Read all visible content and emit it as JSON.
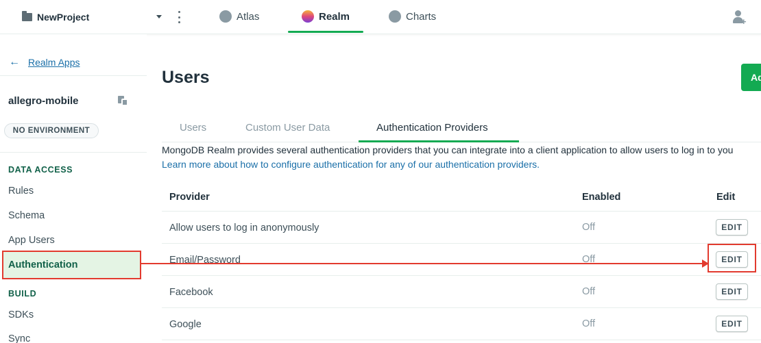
{
  "topbar": {
    "project_name": "NewProject",
    "tabs": [
      {
        "label": "Atlas",
        "icon": "atlas-icon"
      },
      {
        "label": "Realm",
        "icon": "realm-icon",
        "active": true
      },
      {
        "label": "Charts",
        "icon": "charts-icon"
      }
    ]
  },
  "sidebar": {
    "back_label": "Realm Apps",
    "app_name": "allegro-mobile",
    "environment": "NO ENVIRONMENT",
    "section_data_access": "DATA ACCESS",
    "items_data_access": [
      {
        "label": "Rules"
      },
      {
        "label": "Schema"
      },
      {
        "label": "App Users"
      },
      {
        "label": "Authentication",
        "active": true
      }
    ],
    "section_build": "BUILD",
    "items_build": [
      {
        "label": "SDKs"
      },
      {
        "label": "Sync"
      }
    ]
  },
  "main": {
    "title": "Users",
    "add_button_label": "Ad",
    "tabs": [
      {
        "label": "Users"
      },
      {
        "label": "Custom User Data"
      },
      {
        "label": "Authentication Providers",
        "active": true
      }
    ],
    "description": "MongoDB Realm provides several authentication providers that you can integrate into a client application to allow users to log in to you",
    "learn_more": "Learn more about how to configure authentication for any of our authentication providers.",
    "table": {
      "headers": {
        "provider": "Provider",
        "enabled": "Enabled",
        "edit": "Edit"
      },
      "rows": [
        {
          "provider": "Allow users to log in anonymously",
          "enabled": "Off",
          "edit": "EDIT"
        },
        {
          "provider": "Email/Password",
          "enabled": "Off",
          "edit": "EDIT"
        },
        {
          "provider": "Facebook",
          "enabled": "Off",
          "edit": "EDIT"
        },
        {
          "provider": "Google",
          "enabled": "Off",
          "edit": "EDIT"
        }
      ]
    }
  },
  "colors": {
    "accent": "#13aa52",
    "annotation": "#e23a2e",
    "link": "#1a6fa8"
  }
}
